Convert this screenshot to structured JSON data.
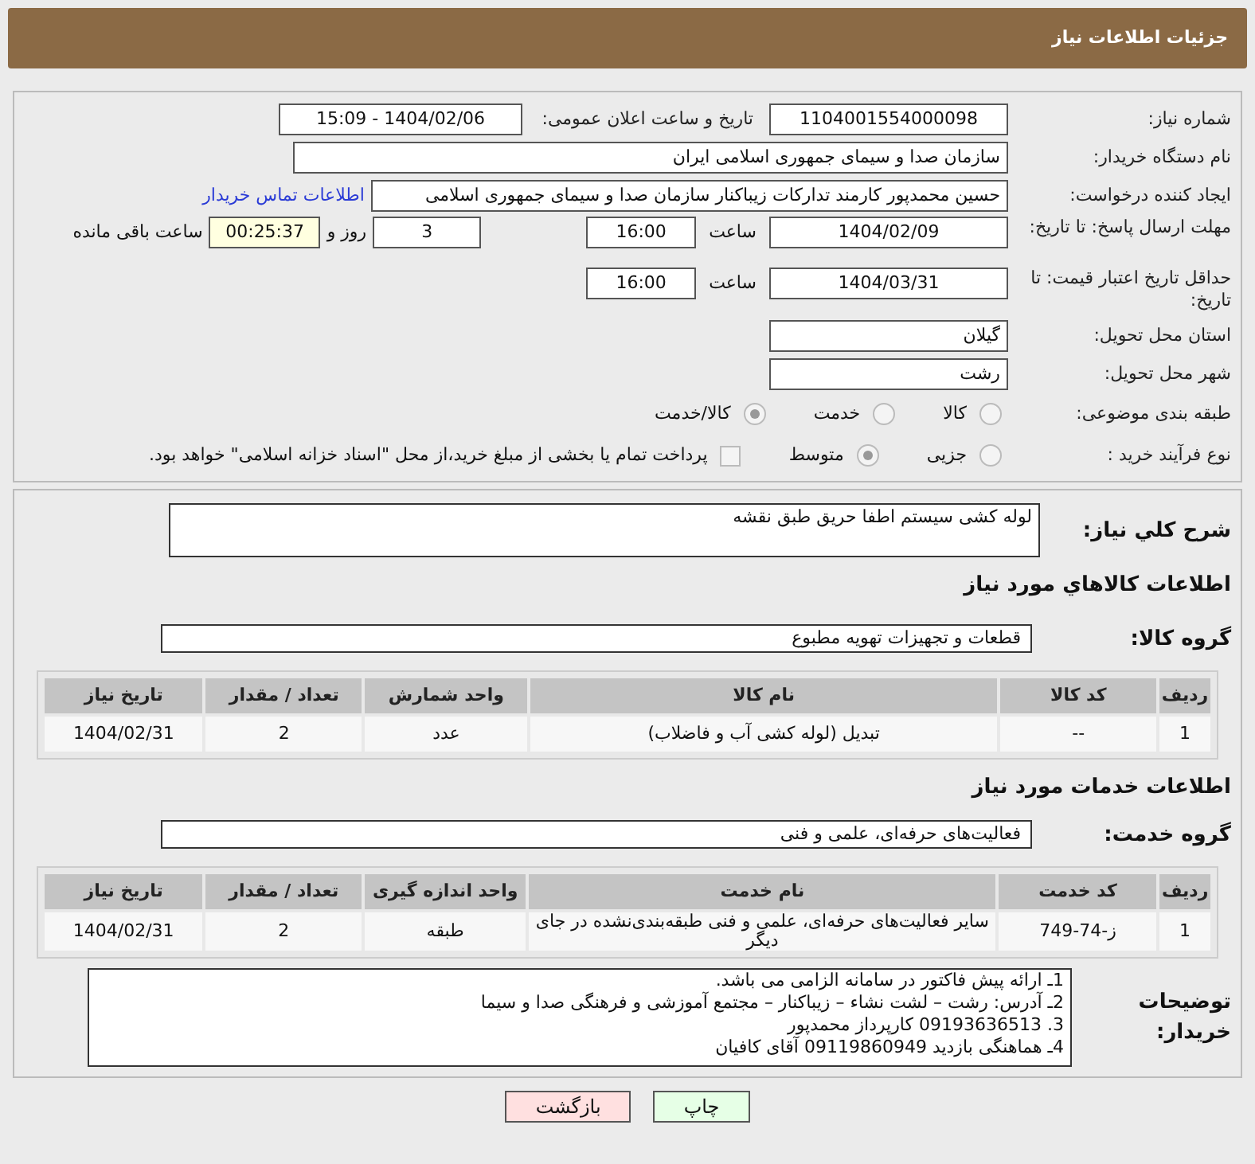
{
  "header": {
    "title": "جزئیات اطلاعات نیاز"
  },
  "need_number": {
    "label": "شماره نیاز:",
    "value": "1104001554000098"
  },
  "announce": {
    "label": "تاریخ و ساعت اعلان عمومی:",
    "value": "1404/02/06 - 15:09"
  },
  "buyer_org": {
    "label": "نام دستگاه خریدار:",
    "value": "سازمان صدا و سیمای جمهوری اسلامی ایران"
  },
  "requester": {
    "label": "ایجاد کننده درخواست:",
    "value": "حسین محمدپور کارمند تدارکات زیباکنار سازمان صدا و سیمای جمهوری اسلامی",
    "link": "اطلاعات تماس خریدار"
  },
  "deadline": {
    "label": "مهلت ارسال پاسخ: تا تاریخ:",
    "date": "1404/02/09",
    "time_label": "ساعت",
    "time": "16:00",
    "days": "3",
    "days_label": "روز و",
    "remaining": "00:25:37",
    "remaining_label": "ساعت باقی مانده"
  },
  "validity": {
    "label": "حداقل تاریخ اعتبار قیمت: تا تاریخ:",
    "date": "1404/03/31",
    "time_label": "ساعت",
    "time": "16:00"
  },
  "province": {
    "label": "استان محل تحویل:",
    "value": "گیلان"
  },
  "city": {
    "label": "شهر محل تحویل:",
    "value": "رشت"
  },
  "category": {
    "label": "طبقه بندی موضوعی:",
    "options": [
      {
        "label": "کالا",
        "selected": false
      },
      {
        "label": "خدمت",
        "selected": false
      },
      {
        "label": "کالا/خدمت",
        "selected": true
      }
    ]
  },
  "process": {
    "label": "نوع فرآیند خرید :",
    "options": [
      {
        "label": "جزیی",
        "selected": false
      },
      {
        "label": "متوسط",
        "selected": true
      }
    ],
    "payment": {
      "label": "پرداخت تمام یا بخشی از مبلغ خرید،از محل \"اسناد خزانه اسلامی\" خواهد بود.",
      "checked": false
    }
  },
  "description": {
    "label": "شرح کلي نياز:",
    "value": "لوله کشی سیستم اطفا حریق طبق نقشه"
  },
  "goods": {
    "title": "اطلاعات کالاهاي مورد نياز",
    "group_label": "گروه کالا:",
    "group_value": "قطعات و تجهیزات تهویه مطبوع",
    "columns": [
      "ردیف",
      "کد کالا",
      "نام کالا",
      "واحد شمارش",
      "تعداد / مقدار",
      "تاریخ نیاز"
    ],
    "rows": [
      [
        "1",
        "--",
        "تبدیل (لوله کشی آب و فاضلاب)",
        "عدد",
        "2",
        "1404/02/31"
      ]
    ]
  },
  "services": {
    "title": "اطلاعات خدمات مورد نیاز",
    "group_label": "گروه خدمت:",
    "group_value": "فعالیت‌های حرفه‌ای، علمی و فنی",
    "columns": [
      "ردیف",
      "کد خدمت",
      "نام خدمت",
      "واحد اندازه گیری",
      "تعداد / مقدار",
      "تاریخ نیاز"
    ],
    "rows": [
      [
        "1",
        "ز-74-749",
        "سایر فعالیت‌های حرفه‌ای، علمی و فنی طبقه‌بندی‌نشده در جای دیگر",
        "طبقه",
        "2",
        "1404/02/31"
      ]
    ]
  },
  "buyer_notes": {
    "label": "توضیحات خریدار:",
    "lines": [
      "1ـ ارائه پیش فاکتور در سامانه الزامی می باشد.",
      "2ـ آدرس: رشت – لشت نشاء – زیباکنار – مجتمع آموزشی و فرهنگی صدا و سیما",
      "3.  09193636513 کارپرداز محمدپور",
      "4ـ هماهنگی بازدید 09119860949 آقای کافیان"
    ]
  },
  "buttons": [
    {
      "label": "چاپ",
      "kind": "print"
    },
    {
      "label": "بازگشت",
      "kind": "back"
    }
  ]
}
